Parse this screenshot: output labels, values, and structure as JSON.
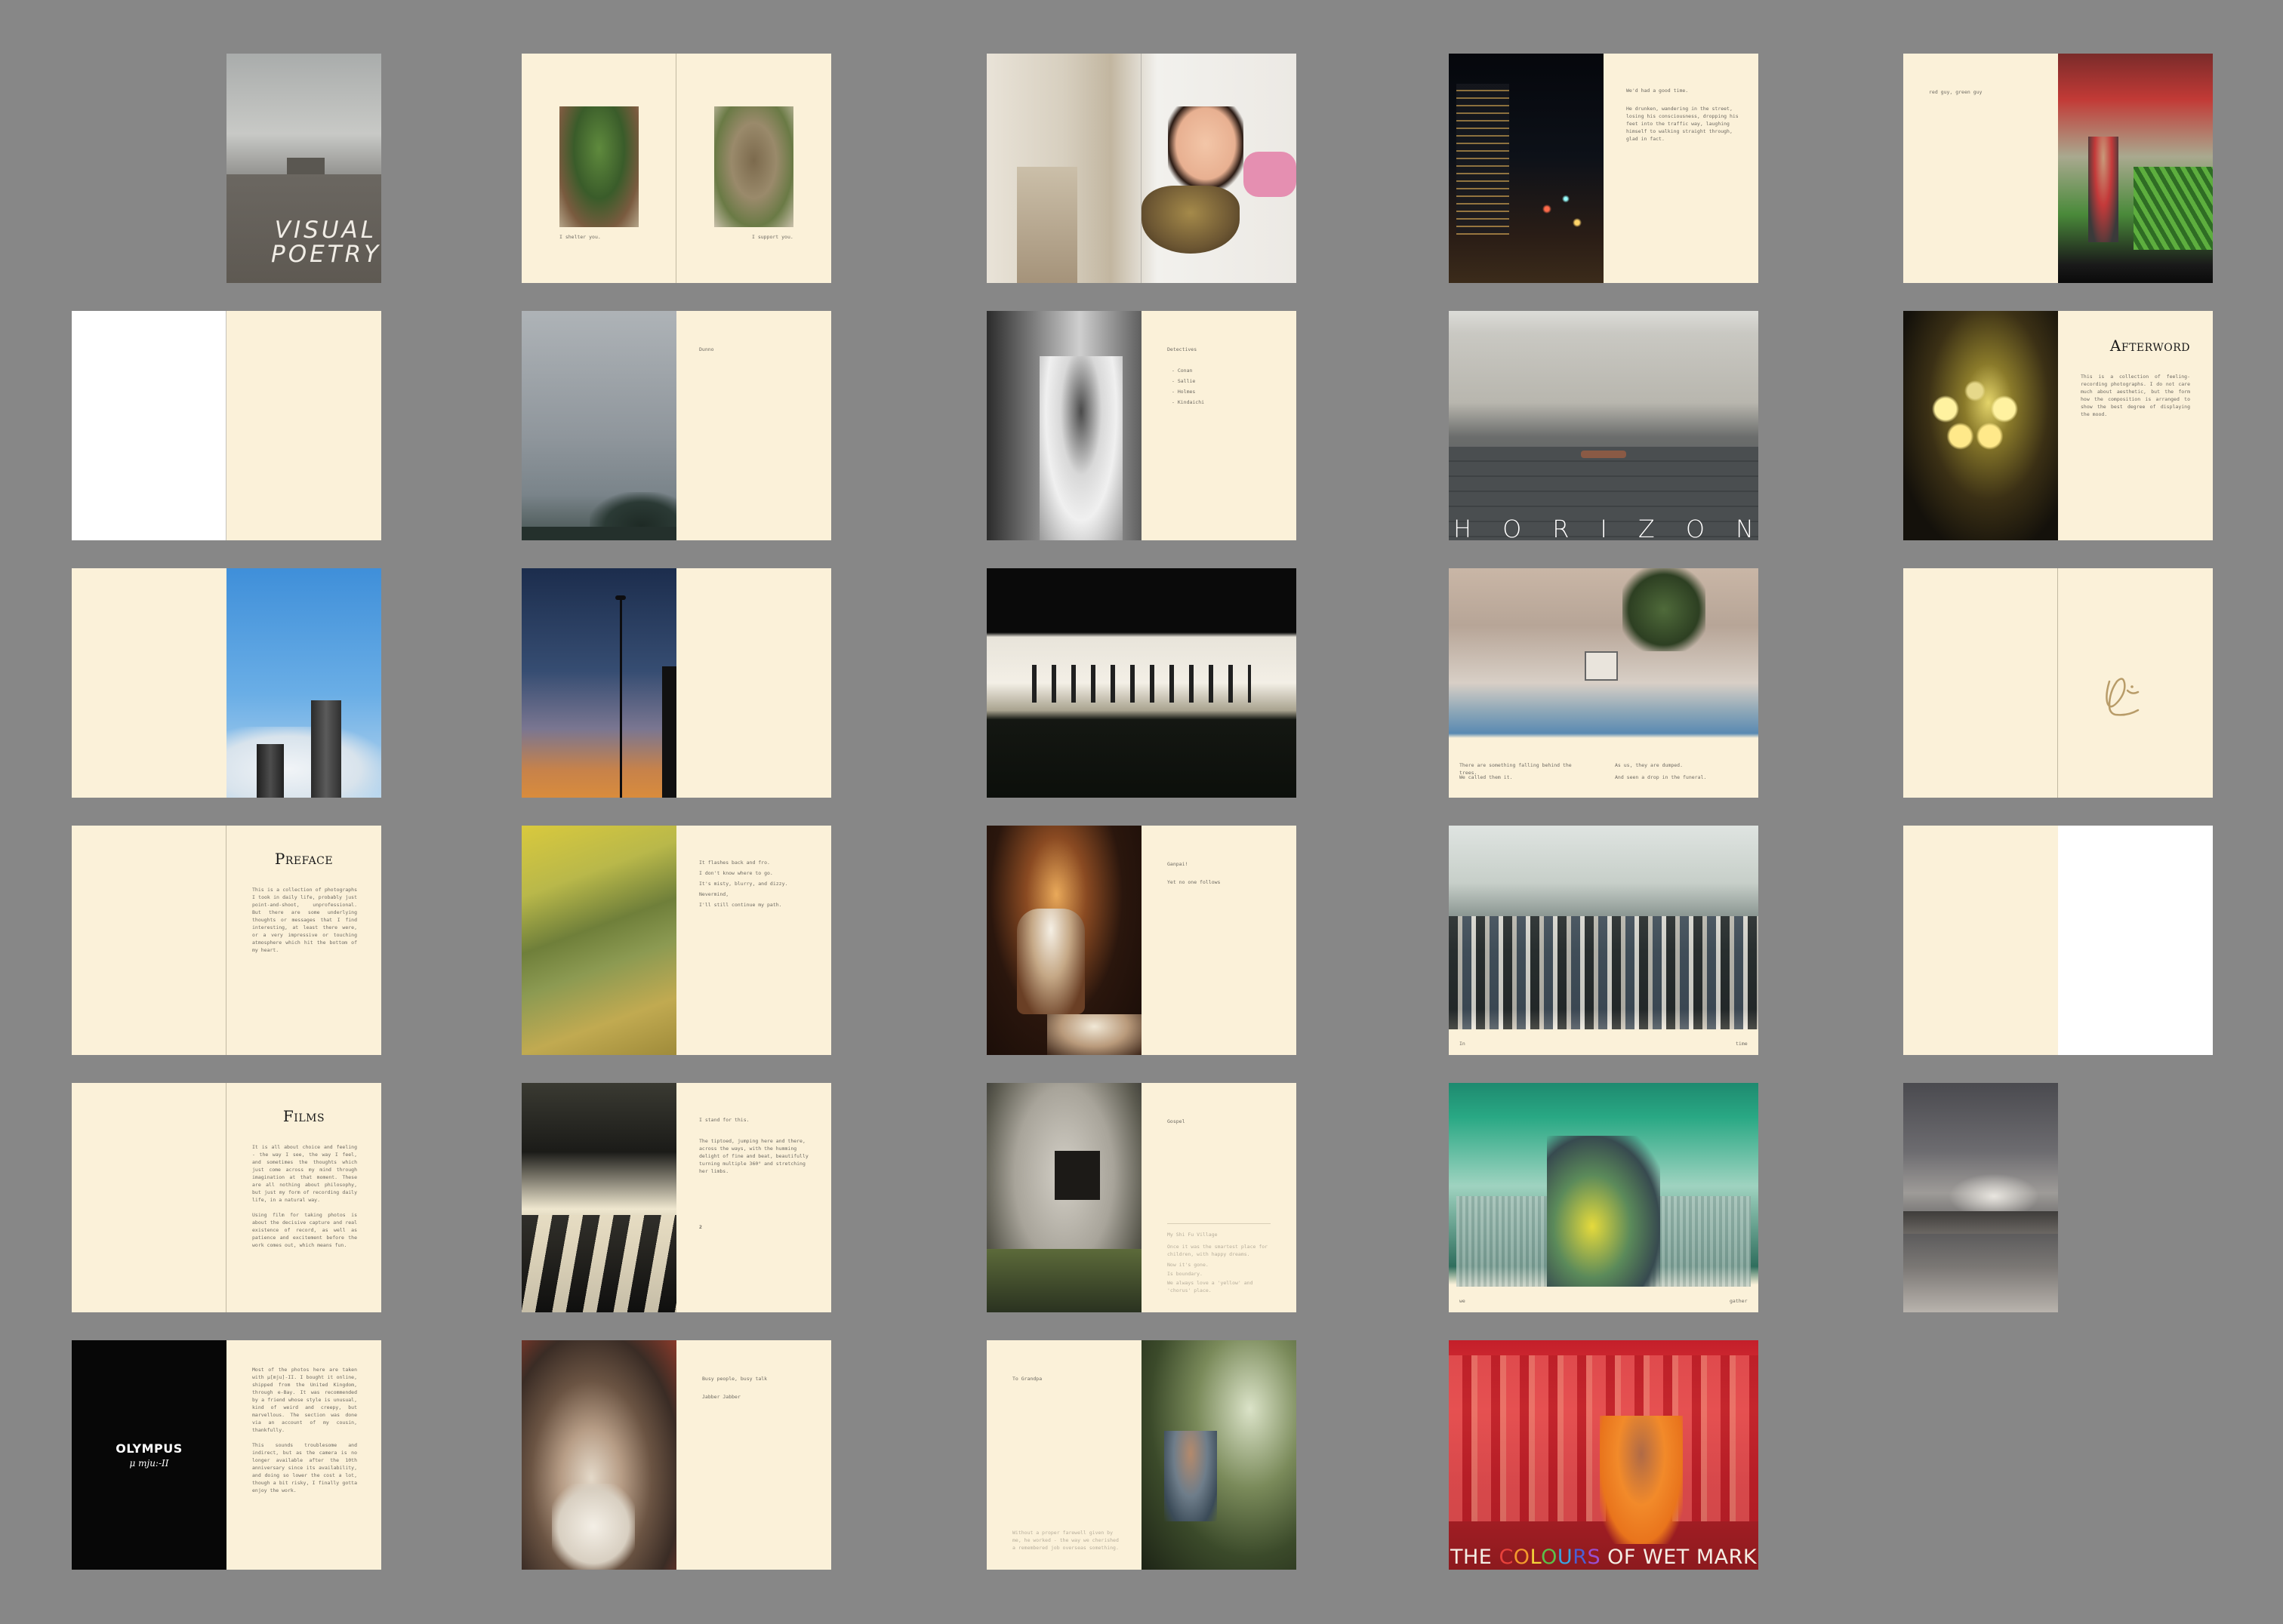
{
  "title": "Visual Poetry",
  "spreads": {
    "cover": {
      "title": "VISUAL POETRY"
    },
    "shelter": {
      "left_caption": "I shelter you.",
      "right_caption": "I support you."
    },
    "dunno": {
      "word": "Dunno"
    },
    "detective": {
      "heading": "Detectives",
      "items": [
        "- Conan",
        "- Sallie",
        "- Holmes",
        "- Kindaichi"
      ]
    },
    "preface": {
      "heading": "Preface",
      "body": "This is a collection of photographs I took in daily life, probably just point-and-shoot, unprofessional. But there are some underlying thoughts or messages that I find interesting, at least there were, or a very impressive or touching atmosphere which hit the bottom of my heart."
    },
    "flashes": {
      "lines": [
        "It flashes back and fro.",
        "I don't know where to go.",
        "It's misty, blurry, and dizzy.",
        "Nevermind,",
        "I'll still continue my path."
      ]
    },
    "ganpei": {
      "line1": "Ganpai!",
      "line2": "Yet no one follows"
    },
    "films": {
      "heading": "Films",
      "body": "It is all about choice and feeling - the way I see, the way I feel, and sometimes the thoughts which just come across my mind through imagination at that moment. These are all nothing about philosophy, but just my form of recording daily life, in a natural way.\n\nUsing film for taking photos is about the decisive capture and real existence of record, as well as patience and excitement before the work comes out, which means fun."
    },
    "stand": {
      "lines": [
        "I stand for this.",
        "The tiptoed, jumping here and there, across the ways, with the humming delight of fine and beat, beautifully turning multiple 360° and stretching her limbs."
      ],
      "mark": "2"
    },
    "gospel": {
      "word": "Gospel",
      "notes": [
        "My Shi Fu Village",
        "Once it was the smartest place for children, with happy dreams.",
        "Now it's gone.",
        "Is boundary.",
        "We always love a 'yellow' and 'chorus' place."
      ]
    },
    "olympus": {
      "brand": "OLYMPUS",
      "model": "μ mju:-II",
      "body": "Most of the photos here are taken with μ[mju]-II. I bought it online, shipped from the United Kingdom, through e-Bay. It was recommended by a friend whose style is unusual, kind of weird and creepy, but marvellous. The section was done via an account of my cousin, thankfully.\n\nThis sounds troublesome and indirect, but as the camera is no longer available after the 10th anniversary since its availability, and doing so lower the cost a lot, though a bit risky, I finally gotta enjoy the work."
    },
    "busy": {
      "line1": "Busy people, busy talk",
      "line2": "Jabber Jabber"
    },
    "grandpa": {
      "heading": "To Grandpa",
      "note": "Without a proper farewell given by me, he worked - the way we cherished a remembered job overseas something."
    },
    "goodtime": {
      "lines": [
        "We'd had a good time.",
        "He drunken, wandering in the street, losing his consciousness, dropping his feet into the traffic way, laughing himself to walking straight through, glad in fact."
      ]
    },
    "horizon": {
      "letters": [
        "H",
        "O",
        "R",
        "I",
        "Z",
        "O",
        "N"
      ]
    },
    "trolley": {
      "left": [
        "There are something falling behind the trees.",
        "We called them it."
      ],
      "right": [
        "As us, they are dumped.",
        "And seen a drop in the funeral."
      ]
    },
    "rush": {
      "left": "In",
      "right": "time"
    },
    "mtr": {
      "left": "we",
      "right": "gather"
    },
    "wetmarket": {
      "words": [
        {
          "text": "THE ",
          "color": "#f4ede4"
        },
        {
          "text": "C",
          "color": "#e8423b"
        },
        {
          "text": "O",
          "color": "#f39a2c"
        },
        {
          "text": "L",
          "color": "#f2d43a"
        },
        {
          "text": "O",
          "color": "#5cbf4a"
        },
        {
          "text": "U",
          "color": "#3ba3e0"
        },
        {
          "text": "R",
          "color": "#4a5fd4"
        },
        {
          "text": "S",
          "color": "#9a4fd0"
        },
        {
          "text": " OF WET MARKET",
          "color": "#f4ede4"
        }
      ]
    },
    "greens": {
      "word": "red guy, green guy"
    },
    "afterword": {
      "heading": "Afterword",
      "body": "This is a collection of feeling-recording photographs. I do not care much about aesthetic, but the form how the composition is arranged to show the best degree of displaying the mood."
    }
  },
  "colors": {
    "background": "#878787",
    "paper": "#fbf1d9"
  }
}
